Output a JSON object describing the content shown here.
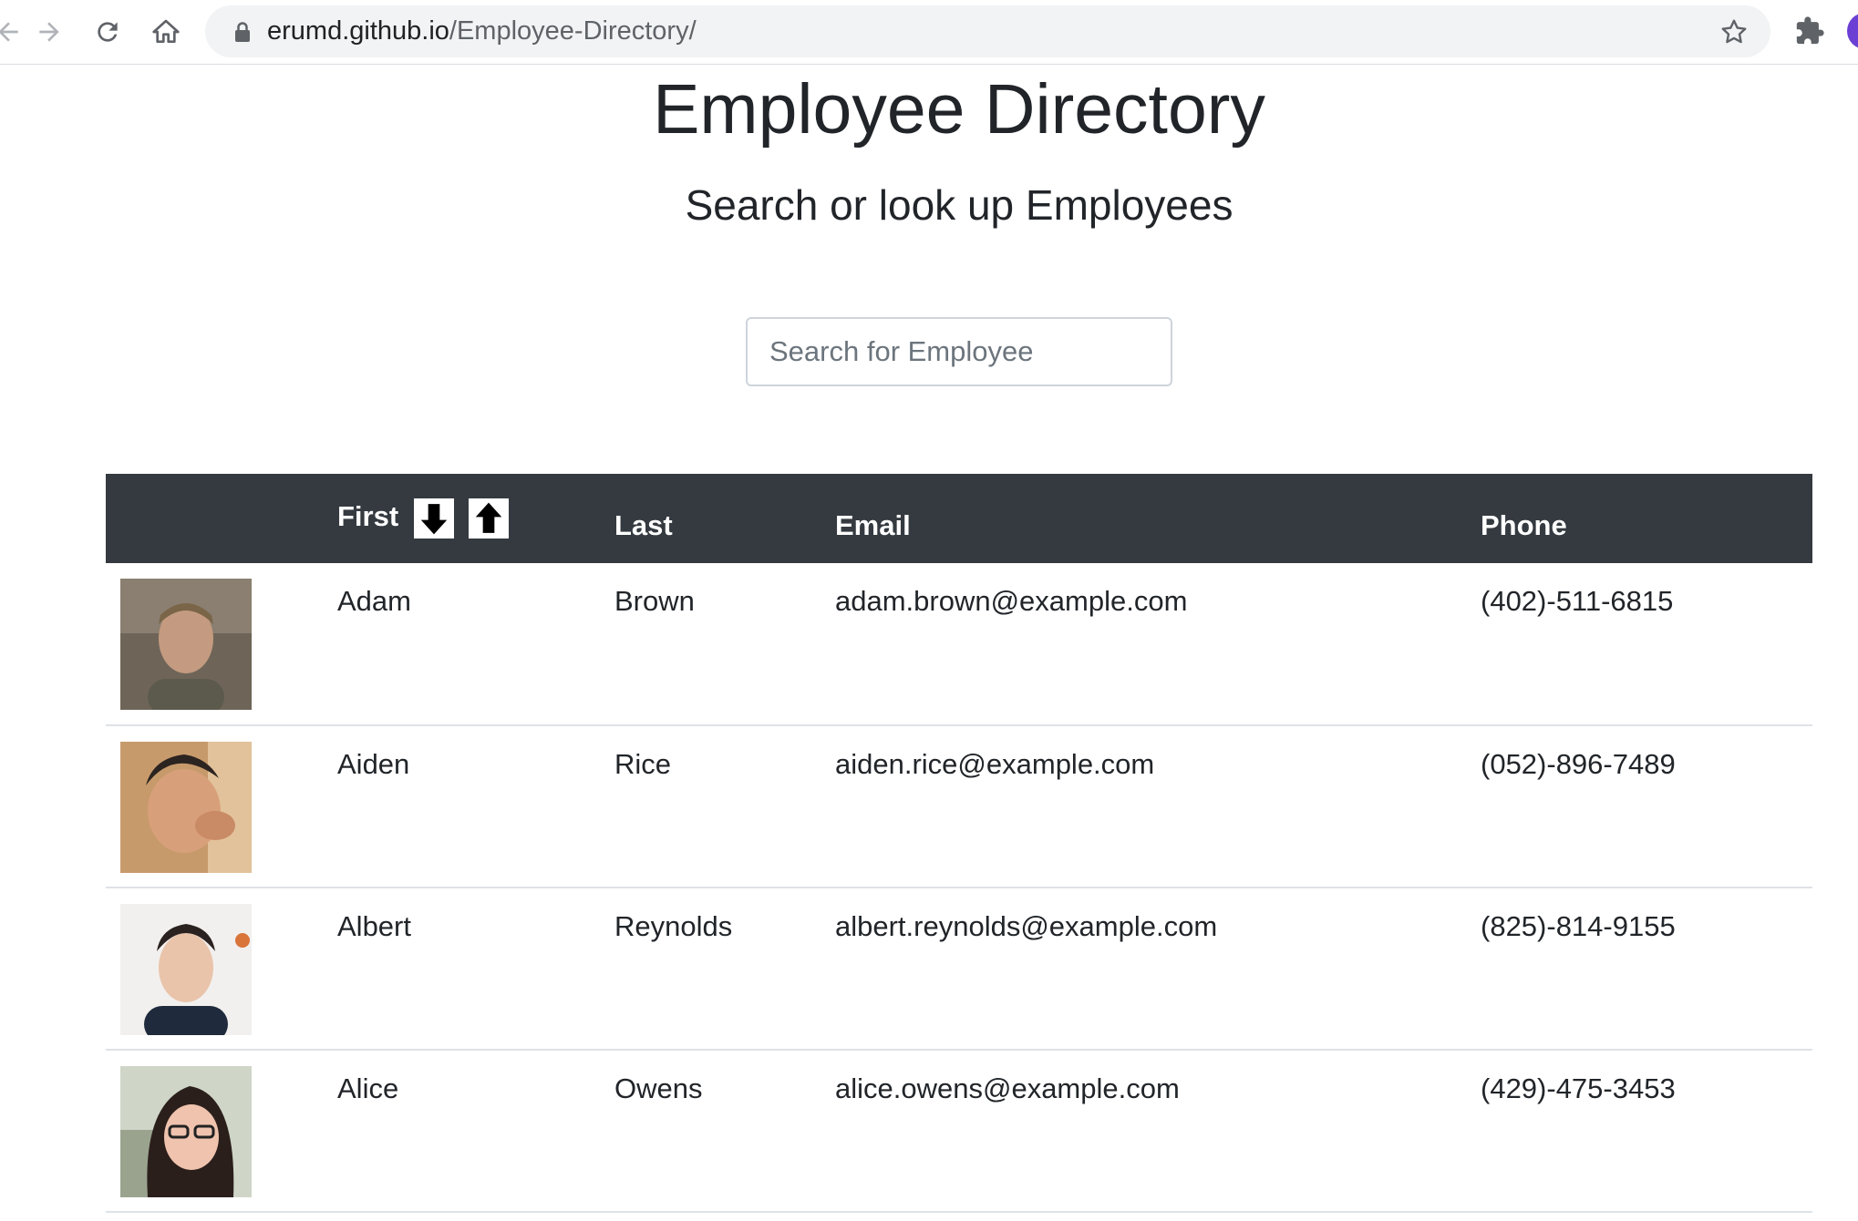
{
  "browser": {
    "url_host": "erumd.github.io",
    "url_path": "/Employee-Directory/"
  },
  "header": {
    "title": "Employee Directory",
    "subtitle": "Search or look up Employees"
  },
  "search": {
    "placeholder": "Search for Employee"
  },
  "table": {
    "columns": {
      "first": "First",
      "last": "Last",
      "email": "Email",
      "phone": "Phone"
    },
    "rows": [
      {
        "first": "Adam",
        "last": "Brown",
        "email": "adam.brown@example.com",
        "phone": "(402)-511-6815"
      },
      {
        "first": "Aiden",
        "last": "Rice",
        "email": "aiden.rice@example.com",
        "phone": "(052)-896-7489"
      },
      {
        "first": "Albert",
        "last": "Reynolds",
        "email": "albert.reynolds@example.com",
        "phone": "(825)-814-9155"
      },
      {
        "first": "Alice",
        "last": "Owens",
        "email": "alice.owens@example.com",
        "phone": "(429)-475-3453"
      }
    ]
  },
  "colors": {
    "table_header_bg": "#343a40",
    "row_divider": "#dee2e6",
    "profile_avatar": "#6b3fd4"
  }
}
